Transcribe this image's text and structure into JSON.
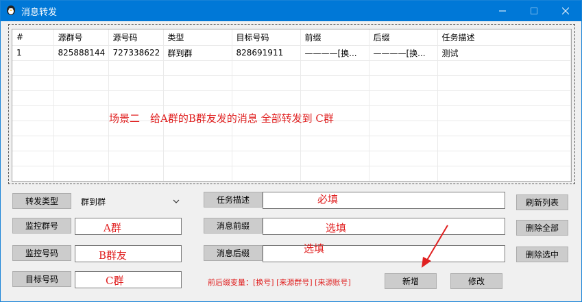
{
  "window": {
    "title": "消息转发"
  },
  "grid": {
    "columns": [
      "#",
      "源群号",
      "源号码",
      "类型",
      "目标号码",
      "前缀",
      "后缀",
      "任务描述"
    ],
    "rows": [
      [
        "1",
        "825888144",
        "727338622",
        "群到群",
        "828691911",
        "————[换...",
        "————[换...",
        "测试"
      ]
    ]
  },
  "annotations": {
    "scene": "场景二　给A群的B群友发的消息 全部转发到 C群",
    "required": "必填",
    "optional_prefix": "选填",
    "optional_suffix": "选填",
    "group_a": "A群",
    "member_b": "B群友",
    "group_c": "C群"
  },
  "form": {
    "forward_type_label": "转发类型",
    "forward_type_value": "群到群",
    "monitor_group_label": "监控群号",
    "monitor_number_label": "监控号码",
    "target_number_label": "目标号码",
    "task_desc_label": "任务描述",
    "msg_prefix_label": "消息前缀",
    "msg_suffix_label": "消息后缀",
    "variables_hint": "前后缀变量：[换号] [来源群号] [来源账号]"
  },
  "buttons": {
    "refresh": "刷新列表",
    "delete_all": "删除全部",
    "delete_selected": "删除选中",
    "add": "新增",
    "edit": "修改"
  },
  "colors": {
    "titlebar": "#0078d7",
    "annotation": "#e02020",
    "button_bg": "#cccccc"
  }
}
